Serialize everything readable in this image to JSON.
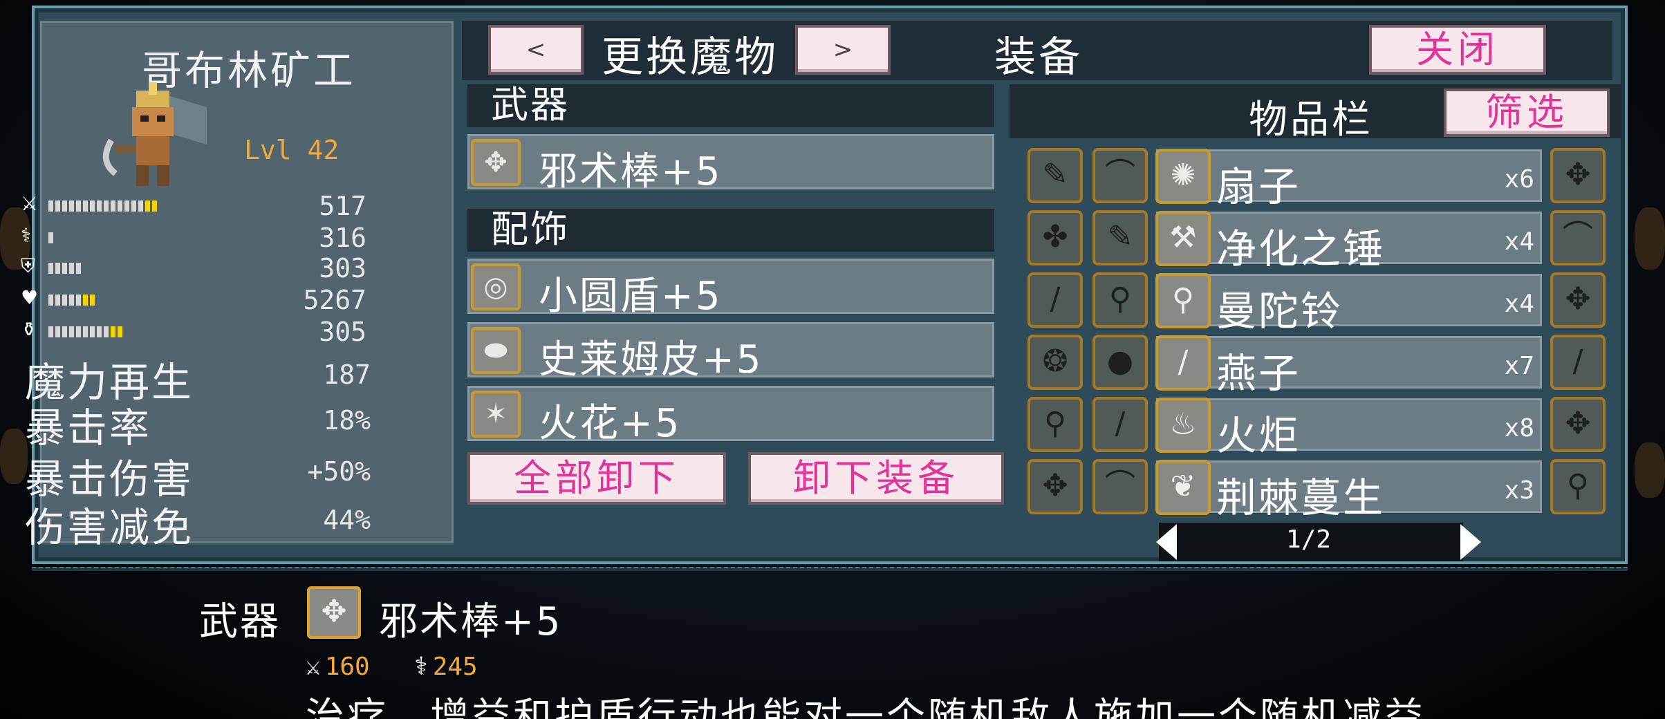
{
  "monster": {
    "name": "哥布林矿工",
    "level": "Lvl 42",
    "stats": [
      {
        "icon": "sword-icon",
        "glyph": "⚔",
        "filled": 14,
        "yellow": 2,
        "value": "517"
      },
      {
        "icon": "staff-icon",
        "glyph": "⚕",
        "filled": 1,
        "yellow": 0,
        "value": "316"
      },
      {
        "icon": "shield-icon",
        "glyph": "⛨",
        "filled": 5,
        "yellow": 0,
        "value": "303"
      },
      {
        "icon": "heart-icon",
        "glyph": "♥",
        "filled": 5,
        "yellow": 2,
        "value": "5267"
      },
      {
        "icon": "potion-icon",
        "glyph": "⚱",
        "filled": 9,
        "yellow": 2,
        "value": "305"
      }
    ],
    "attributes": [
      {
        "label": "魔力再生",
        "value": "187"
      },
      {
        "label": "暴击率",
        "value": "18%"
      },
      {
        "label": "暴击伤害",
        "value": "+50%"
      },
      {
        "label": "伤害减免",
        "value": "44%"
      }
    ]
  },
  "header": {
    "prev": "<",
    "next": ">",
    "change_monster": "更换魔物",
    "title": "装备",
    "close": "关闭"
  },
  "equipment": {
    "weapon_title": "武器",
    "weapon": {
      "icon": "cursed-staff-icon",
      "glyph": "✥",
      "name": "邪术棒+5"
    },
    "accessory_title": "配饰",
    "accessories": [
      {
        "icon": "round-shield-icon",
        "glyph": "◎",
        "name": "小圆盾+5"
      },
      {
        "icon": "slime-skin-icon",
        "glyph": "⬬",
        "name": "史莱姆皮+5"
      },
      {
        "icon": "spark-icon",
        "glyph": "✶",
        "name": "火花+5"
      }
    ],
    "unequip_all": "全部卸下",
    "unequip": "卸下装备"
  },
  "inventory": {
    "title": "物品栏",
    "filter": "筛选",
    "grid_left": [
      [
        "✎",
        "⌒"
      ],
      [
        "✤",
        "✎"
      ],
      [
        "∕",
        "⚲"
      ],
      [
        "❂",
        "●"
      ],
      [
        "⚲",
        "∕"
      ],
      [
        "✥",
        "⌒"
      ]
    ],
    "grid_right": [
      "✥",
      "⌒",
      "✥",
      "∕",
      "✥",
      "⚲"
    ],
    "items": [
      {
        "icon": "fan-icon",
        "glyph": "✺",
        "name": "扇子",
        "qty": "x6"
      },
      {
        "icon": "hammer-icon",
        "glyph": "⚒",
        "name": "净化之锤",
        "qty": "x4"
      },
      {
        "icon": "mandragora-bell-icon",
        "glyph": "⚲",
        "name": "曼陀铃",
        "qty": "x4"
      },
      {
        "icon": "swallow-icon",
        "glyph": "∕",
        "name": "燕子",
        "qty": "x7"
      },
      {
        "icon": "torch-icon",
        "glyph": "♨",
        "name": "火炬",
        "qty": "x8"
      },
      {
        "icon": "thorn-icon",
        "glyph": "❦",
        "name": "荆棘蔓生",
        "qty": "x3"
      }
    ],
    "page": "1/2"
  },
  "detail": {
    "category": "武器",
    "icon": "cursed-staff-icon",
    "glyph": "✥",
    "name": "邪术棒+5",
    "attack": "160",
    "magic": "245",
    "description": "治疗、增益和护盾行动也能对一个随机敌人施加一个随机减益。"
  }
}
